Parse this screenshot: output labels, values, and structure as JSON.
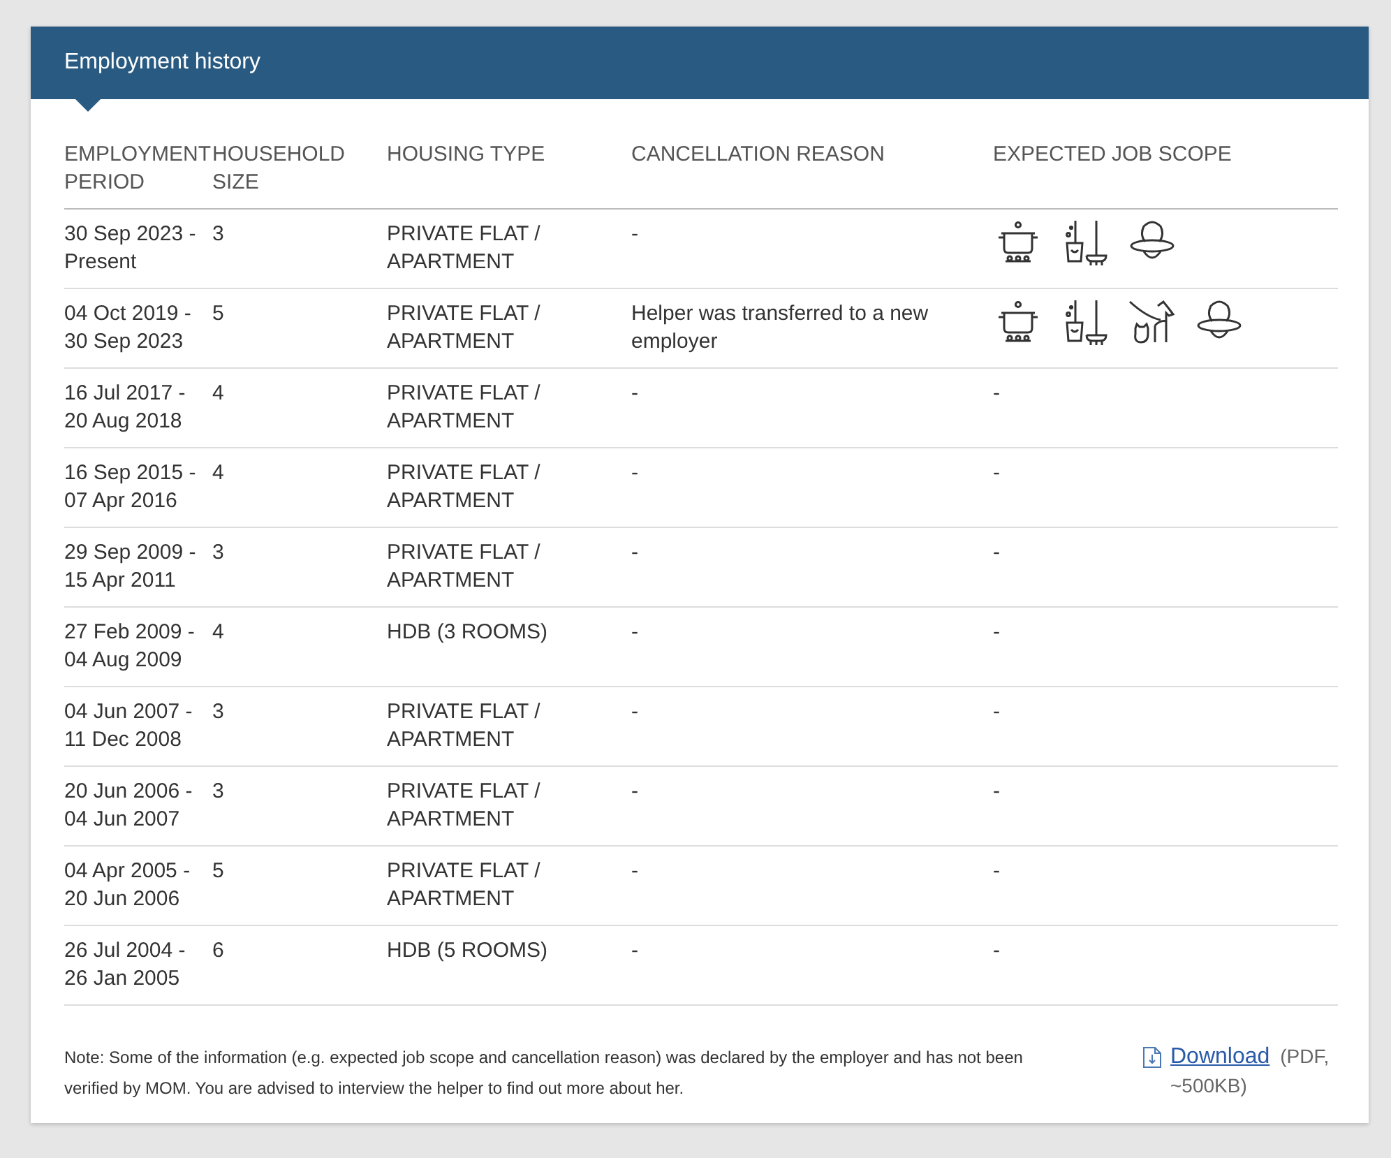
{
  "panel": {
    "title": "Employment history"
  },
  "table": {
    "columns": [
      "EMPLOYMENT PERIOD",
      "HOUSEHOLD SIZE",
      "HOUSING TYPE",
      "CANCELLATION REASON",
      "EXPECTED JOB SCOPE"
    ],
    "rows": [
      {
        "period": "30 Sep 2023 - Present",
        "size": "3",
        "housing": "PRIVATE FLAT / APARTMENT",
        "reason": "-",
        "job_scope": [
          {
            "kind": "cooking"
          },
          {
            "kind": "cleaning"
          },
          {
            "kind": "infant-care"
          }
        ]
      },
      {
        "period": "04 Oct 2019 - 30 Sep 2023",
        "size": "5",
        "housing": "PRIVATE FLAT / APARTMENT",
        "reason": "Helper was transferred to a new employer",
        "job_scope": [
          {
            "kind": "cooking"
          },
          {
            "kind": "cleaning"
          },
          {
            "kind": "pet-care"
          },
          {
            "kind": "infant-care"
          }
        ]
      },
      {
        "period": "16 Jul 2017 - 20 Aug 2018",
        "size": "4",
        "housing": "PRIVATE FLAT / APARTMENT",
        "reason": "-",
        "job_scope_text": "-"
      },
      {
        "period": "16 Sep 2015 - 07 Apr 2016",
        "size": "4",
        "housing": "PRIVATE FLAT / APARTMENT",
        "reason": "-",
        "job_scope_text": "-"
      },
      {
        "period": "29 Sep 2009 - 15 Apr 2011",
        "size": "3",
        "housing": "PRIVATE FLAT / APARTMENT",
        "reason": "-",
        "job_scope_text": "-"
      },
      {
        "period": "27 Feb 2009 - 04 Aug 2009",
        "size": "4",
        "housing": "HDB (3 ROOMS)",
        "reason": "-",
        "job_scope_text": "-"
      },
      {
        "period": "04 Jun 2007 - 11 Dec 2008",
        "size": "3",
        "housing": "PRIVATE FLAT / APARTMENT",
        "reason": "-",
        "job_scope_text": "-"
      },
      {
        "period": "20 Jun 2006 - 04 Jun 2007",
        "size": "3",
        "housing": "PRIVATE FLAT / APARTMENT",
        "reason": "-",
        "job_scope_text": "-"
      },
      {
        "period": "04 Apr 2005 - 20 Jun 2006",
        "size": "5",
        "housing": "PRIVATE FLAT / APARTMENT",
        "reason": "-",
        "job_scope_text": "-"
      },
      {
        "period": "26 Jul 2004 - 26 Jan 2005",
        "size": "6",
        "housing": "HDB (5 ROOMS)",
        "reason": "-",
        "job_scope_text": "-"
      }
    ]
  },
  "note": "Note: Some of the information (e.g. expected job scope and cancellation reason) was declared by the employer and has not been verified by MOM. You are advised to interview the helper to find out more about her.",
  "download": {
    "link": "Download",
    "info": "(PDF, ~500KB)"
  }
}
